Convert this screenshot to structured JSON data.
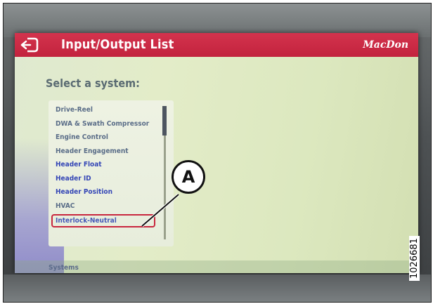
{
  "header": {
    "title": "Input/Output List",
    "brand": "MacDon",
    "back_icon": "back-arrow-icon"
  },
  "prompt": "Select a system:",
  "systems": {
    "items": [
      {
        "label": "Drive-Reel"
      },
      {
        "label": "DWA & Swath Compressor"
      },
      {
        "label": "Engine Control"
      },
      {
        "label": "Header Engagement"
      },
      {
        "label": "Header Float"
      },
      {
        "label": "Header ID"
      },
      {
        "label": "Header Position"
      },
      {
        "label": "HVAC"
      },
      {
        "label": "Interlock-Neutral"
      }
    ],
    "selected_index": 8
  },
  "status": {
    "label": "Systems"
  },
  "callout": {
    "label": "A"
  },
  "figure_id": "1026681",
  "colors": {
    "title_bar": "#c8263e",
    "screen_background": "#dfe9c6",
    "selection_outline": "#c8263e",
    "list_text": "#3446b6"
  }
}
